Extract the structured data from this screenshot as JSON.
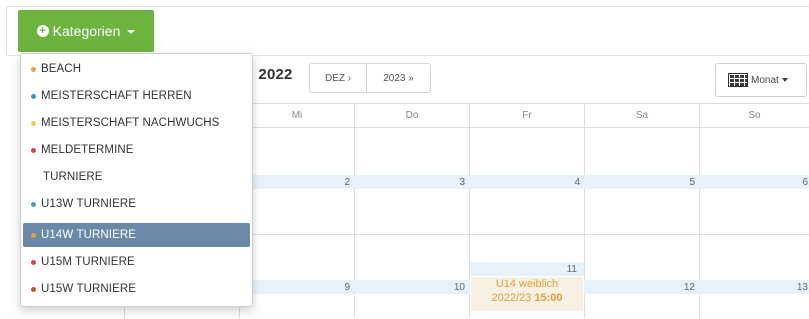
{
  "toolbar": {
    "categories_label": "Kategorien",
    "month_title": "R 2022",
    "prev_label": "DEZ ›",
    "next_label": "2023 »",
    "view_label": "Monat"
  },
  "dropdown": {
    "items": [
      {
        "label": "BEACH",
        "color": "#e8a04c"
      },
      {
        "label": "MEISTERSCHAFT HERREN",
        "color": "#3f8fd1"
      },
      {
        "label": "MEISTERSCHAFT NACHWUCHS",
        "color": "#f2d04a"
      },
      {
        "label": "MELDETERMINE",
        "color": "#c0504d"
      },
      {
        "label": "TURNIERE",
        "color": ""
      },
      {
        "label": "U13W TURNIERE",
        "color": "#3fa9a2"
      },
      {
        "label": "U14W TURNIERE",
        "color": "#e6a04a",
        "active": true
      },
      {
        "label": "U15M TURNIERE",
        "color": "#c0504d"
      },
      {
        "label": "U15W TURNIERE",
        "color": "#b85a3e"
      }
    ]
  },
  "calendar": {
    "day_headers": [
      "Mi",
      "Do",
      "Fr",
      "Sa",
      "So"
    ],
    "week1": [
      "2",
      "3",
      "4",
      "5",
      "6"
    ],
    "week2_fr_top": "11",
    "week2": [
      "9",
      "10",
      "12",
      "13"
    ],
    "event": {
      "title": "U14 weiblich",
      "season": "2022/23",
      "time": "15:00",
      "color": "#e69c3a"
    }
  },
  "colors": {
    "button_green": "#6cb33f",
    "active_item": "#6a89a8",
    "day_band": "#e5f1fb"
  }
}
